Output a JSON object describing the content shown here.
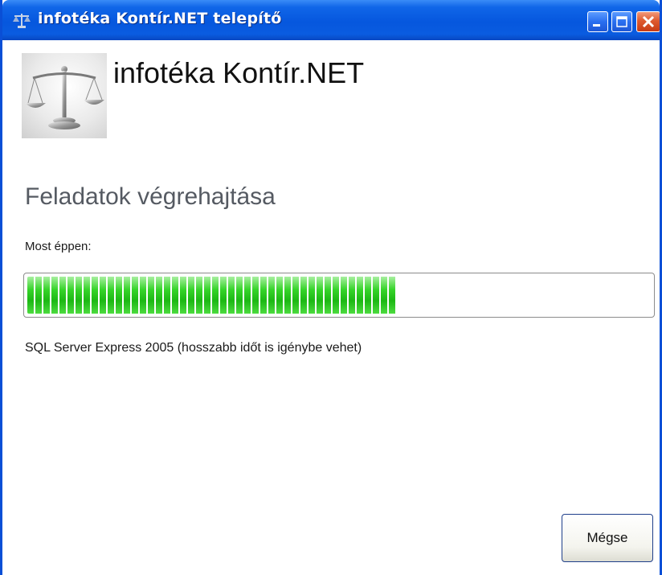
{
  "window": {
    "title": "infotéka Kontír.NET telepítő"
  },
  "header": {
    "app_name": "infotéka Kontír.NET",
    "logo_icon": "scales-of-justice-icon"
  },
  "main": {
    "section_title": "Feladatok végrehajtása",
    "now_label": "Most éppen:",
    "progress_percent": 59,
    "status_text": "SQL Server Express 2005 (hosszabb időt is igénybe vehet)"
  },
  "footer": {
    "cancel_label": "Mégse"
  },
  "colors": {
    "titlebar": "#0657de",
    "progress_green": "#1cb814",
    "close_button": "#de5a2f"
  }
}
